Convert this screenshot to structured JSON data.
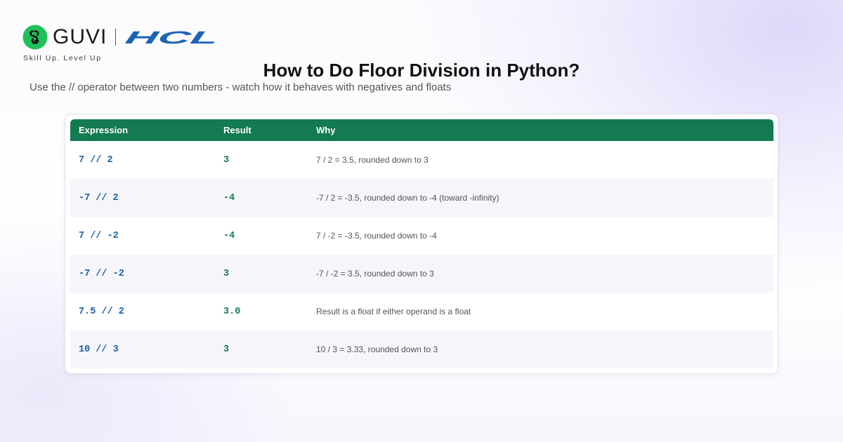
{
  "brand": {
    "name": "GUVI",
    "partner": "HCL",
    "tagline": "Skill Up. Level Up",
    "colors": {
      "guvi_green": "#1fc05a",
      "hcl_blue": "#1d63b4"
    }
  },
  "title": "How to Do Floor Division in Python?",
  "subtitle": "Use the // operator between two numbers - watch how it behaves with negatives and floats",
  "table": {
    "header_color": "#137a51",
    "columns": [
      "Expression",
      "Result",
      "Why"
    ],
    "rows": [
      {
        "expression": "7 // 2",
        "result": "3",
        "why": "7 / 2 = 3.5, rounded down to 3"
      },
      {
        "expression": "-7 // 2",
        "result": "-4",
        "why": "-7 / 2 = -3.5, rounded down to -4 (toward -infinity)"
      },
      {
        "expression": "7 // -2",
        "result": "-4",
        "why": "7 / -2 = -3.5, rounded down to -4"
      },
      {
        "expression": "-7 // -2",
        "result": "3",
        "why": "-7 / -2 = 3.5, rounded down to 3"
      },
      {
        "expression": "7.5 // 2",
        "result": "3.0",
        "why": "Result is a float if either operand is a float"
      },
      {
        "expression": "10 // 3",
        "result": "3",
        "why": "10 / 3 = 3.33, rounded down to 3"
      }
    ]
  }
}
